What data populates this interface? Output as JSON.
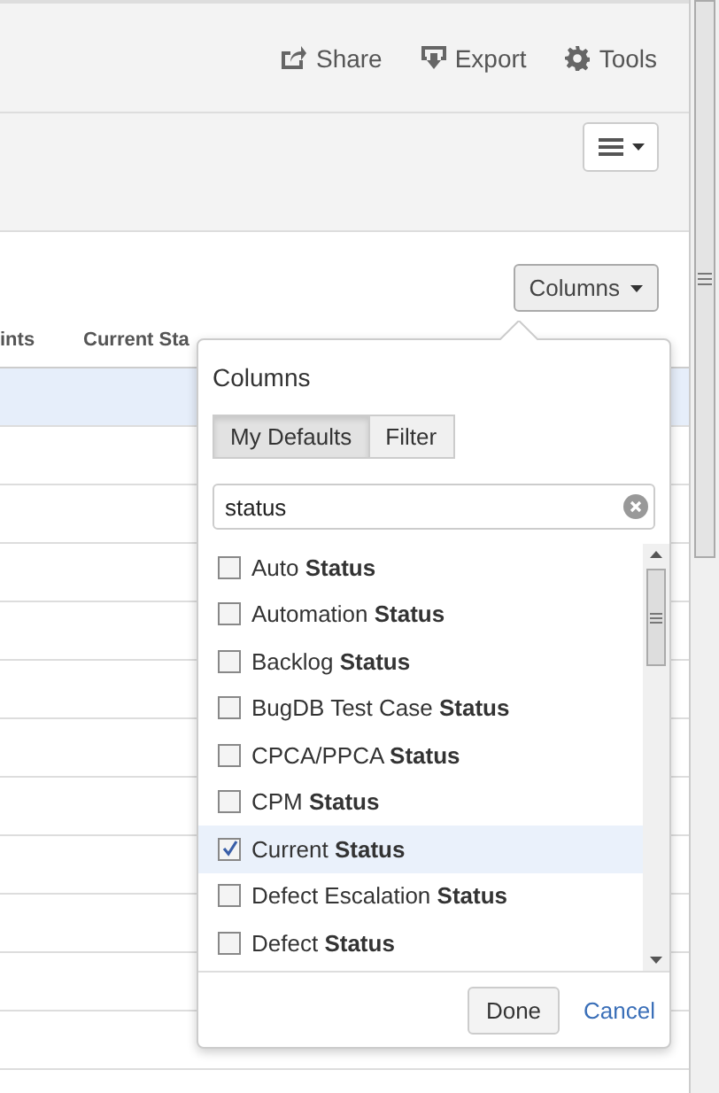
{
  "toolbar": {
    "actions": [
      {
        "kind": "share",
        "label": "Share"
      },
      {
        "kind": "export",
        "label": "Export"
      },
      {
        "kind": "tools",
        "label": "Tools"
      }
    ]
  },
  "table": {
    "columns": [
      "ints",
      "Current Sta"
    ],
    "rows": [
      {
        "selected": true
      },
      {
        "selected": false
      },
      {
        "selected": false
      },
      {
        "selected": false
      },
      {
        "selected": false
      },
      {
        "selected": false
      },
      {
        "selected": false
      },
      {
        "selected": false
      },
      {
        "selected": false
      },
      {
        "selected": false
      },
      {
        "selected": false
      },
      {
        "selected": false
      }
    ]
  },
  "columns_button": {
    "label": "Columns"
  },
  "columns_popover": {
    "title": "Columns",
    "tabs": [
      {
        "label": "My Defaults",
        "selected": true
      },
      {
        "label": "Filter",
        "selected": false
      }
    ],
    "search": {
      "value": "status"
    },
    "items": [
      {
        "label": "Auto **Status**",
        "checked": false
      },
      {
        "label": "Automation **Status**",
        "checked": false
      },
      {
        "label": "Backlog **Status**",
        "checked": false
      },
      {
        "label": "BugDB Test Case **Status**",
        "checked": false
      },
      {
        "label": "CPCA/PPCA **Status**",
        "checked": false
      },
      {
        "label": "CPM **Status**",
        "checked": false
      },
      {
        "label": "Current **Status**",
        "checked": true
      },
      {
        "label": "Defect Escalation **Status**",
        "checked": false
      },
      {
        "label": "Defect **Status**",
        "checked": false
      }
    ],
    "buttons": [
      {
        "kind": "primary",
        "label": "Done"
      },
      {
        "kind": "link",
        "label": "Cancel"
      }
    ]
  }
}
